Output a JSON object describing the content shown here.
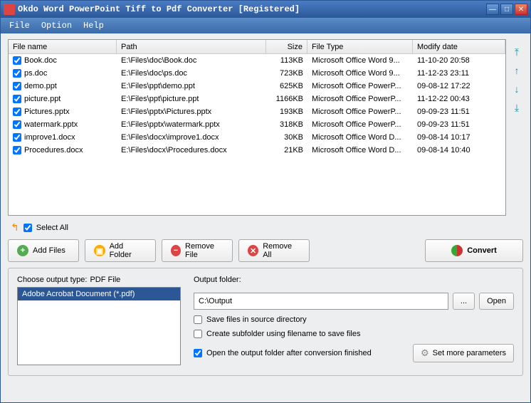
{
  "title": "Okdo Word PowerPoint Tiff to Pdf Converter [Registered]",
  "menu": {
    "file": "File",
    "option": "Option",
    "help": "Help"
  },
  "columns": {
    "name": "File name",
    "path": "Path",
    "size": "Size",
    "type": "File Type",
    "date": "Modify date"
  },
  "files": [
    {
      "name": "Book.doc",
      "path": "E:\\Files\\doc\\Book.doc",
      "size": "113KB",
      "type": "Microsoft Office Word 9...",
      "date": "11-10-20 20:58"
    },
    {
      "name": "ps.doc",
      "path": "E:\\Files\\doc\\ps.doc",
      "size": "723KB",
      "type": "Microsoft Office Word 9...",
      "date": "11-12-23 23:11"
    },
    {
      "name": "demo.ppt",
      "path": "E:\\Files\\ppt\\demo.ppt",
      "size": "625KB",
      "type": "Microsoft Office PowerP...",
      "date": "09-08-12 17:22"
    },
    {
      "name": "picture.ppt",
      "path": "E:\\Files\\ppt\\picture.ppt",
      "size": "1166KB",
      "type": "Microsoft Office PowerP...",
      "date": "11-12-22 00:43"
    },
    {
      "name": "Pictures.pptx",
      "path": "E:\\Files\\pptx\\Pictures.pptx",
      "size": "193KB",
      "type": "Microsoft Office PowerP...",
      "date": "09-09-23 11:51"
    },
    {
      "name": "watermark.pptx",
      "path": "E:\\Files\\pptx\\watermark.pptx",
      "size": "318KB",
      "type": "Microsoft Office PowerP...",
      "date": "09-09-23 11:51"
    },
    {
      "name": "improve1.docx",
      "path": "E:\\Files\\docx\\improve1.docx",
      "size": "30KB",
      "type": "Microsoft Office Word D...",
      "date": "09-08-14 10:17"
    },
    {
      "name": "Procedures.docx",
      "path": "E:\\Files\\docx\\Procedures.docx",
      "size": "21KB",
      "type": "Microsoft Office Word D...",
      "date": "09-08-14 10:40"
    }
  ],
  "selectAll": "Select All",
  "buttons": {
    "addFiles": "Add Files",
    "addFolder": "Add Folder",
    "removeFile": "Remove File",
    "removeAll": "Remove All",
    "convert": "Convert"
  },
  "outputType": {
    "label": "Choose output type:",
    "value": "PDF File",
    "item": "Adobe Acrobat Document (*.pdf)"
  },
  "outputFolder": {
    "label": "Output folder:",
    "value": "C:\\Output",
    "browse": "...",
    "open": "Open"
  },
  "opts": {
    "save": "Save files in source directory",
    "sub": "Create subfolder using filename to save files",
    "openAfter": "Open the output folder after conversion finished"
  },
  "params": "Set more parameters"
}
